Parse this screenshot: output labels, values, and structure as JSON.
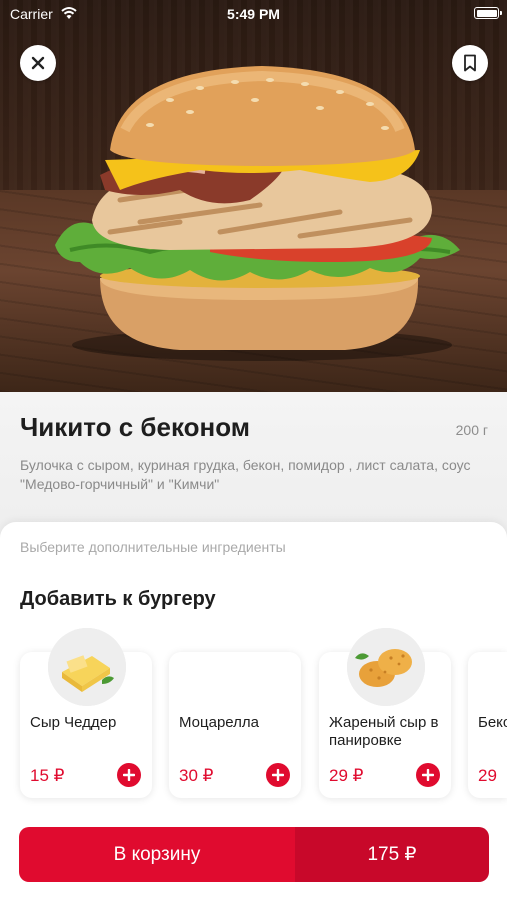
{
  "status_bar": {
    "carrier": "Carrier",
    "time": "5:49 PM"
  },
  "product": {
    "title": "Чикито с беконом",
    "weight": "200 г",
    "description": "Булочка с сыром, куриная грудка, бекон, помидор , лист салата, соус \"Медово-горчичный\" и \"Кимчи\""
  },
  "sheet": {
    "hint": "Выберите дополнительные ингредиенты",
    "section_title": "Добавить к бургеру",
    "items": [
      {
        "name": "Сыр Чеддер",
        "price": "15 ₽",
        "image": "cheddar-cheese"
      },
      {
        "name": "Моцарелла",
        "price": "30 ₽",
        "image": "none"
      },
      {
        "name": "Жареный сыр в панировке",
        "price": "29 ₽",
        "image": "fried-cheese"
      },
      {
        "name": "Беко",
        "price": "29",
        "image": "none"
      }
    ]
  },
  "cart": {
    "label": "В корзину",
    "total": "175 ₽"
  },
  "colors": {
    "accent": "#e00b2f",
    "accent_dark": "#c8082a"
  }
}
